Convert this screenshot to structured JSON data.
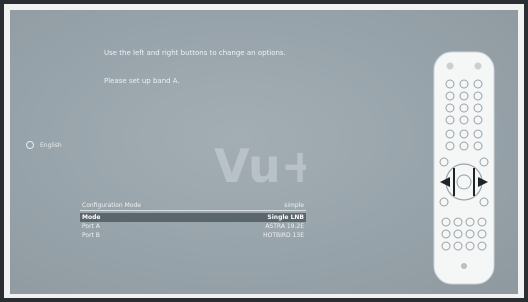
{
  "instructions": {
    "line1": "Use the left and right buttons to change an options.",
    "line2": "Please set up band A."
  },
  "language": {
    "label": "English"
  },
  "logo": {
    "text": "Vu+"
  },
  "menu": {
    "header": {
      "label": "Configuration Mode",
      "value": "simple"
    },
    "items": [
      {
        "label": "Mode",
        "value": "Single LNB"
      },
      {
        "label": "Port A",
        "value": "ASTRA 19.2E"
      },
      {
        "label": "Port B",
        "value": "HOTBIRD 13E"
      }
    ]
  },
  "colors": {
    "screen_bg": "#97a3aa",
    "selection_bg": "#5a656c",
    "text": "#eef2f4",
    "remote_body": "#f4f5f5"
  }
}
